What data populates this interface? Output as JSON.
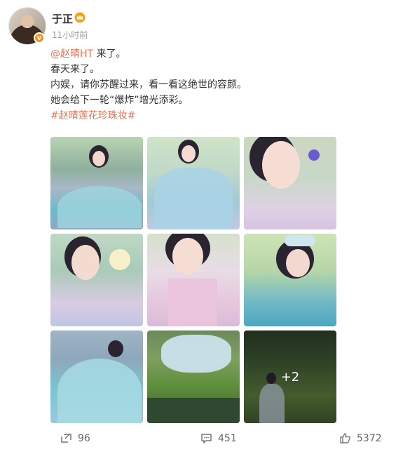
{
  "post": {
    "author": "于正",
    "time": "11小时前",
    "lines": [
      {
        "mention": "@赵晴HT",
        "text": " 来了。"
      },
      {
        "text": "春天来了。"
      },
      {
        "text": "内娱，请你苏醒过来，看一看这绝世的容颜。"
      },
      {
        "text": "她会给下一轮“爆炸”增光添彩。"
      }
    ],
    "hashtag": "#赵晴莲花珍珠妆#",
    "more_photos": "+2"
  },
  "actions": {
    "repost_count": "96",
    "comment_count": "451",
    "like_count": "5372"
  },
  "icons": {
    "verify": "verified-badge-icon",
    "vip": "vip-crown-icon",
    "repost": "repost-icon",
    "comment": "comment-icon",
    "like": "like-icon"
  },
  "colors": {
    "link": "#eb7350",
    "badge": "#f7931e",
    "muted": "#999999"
  }
}
